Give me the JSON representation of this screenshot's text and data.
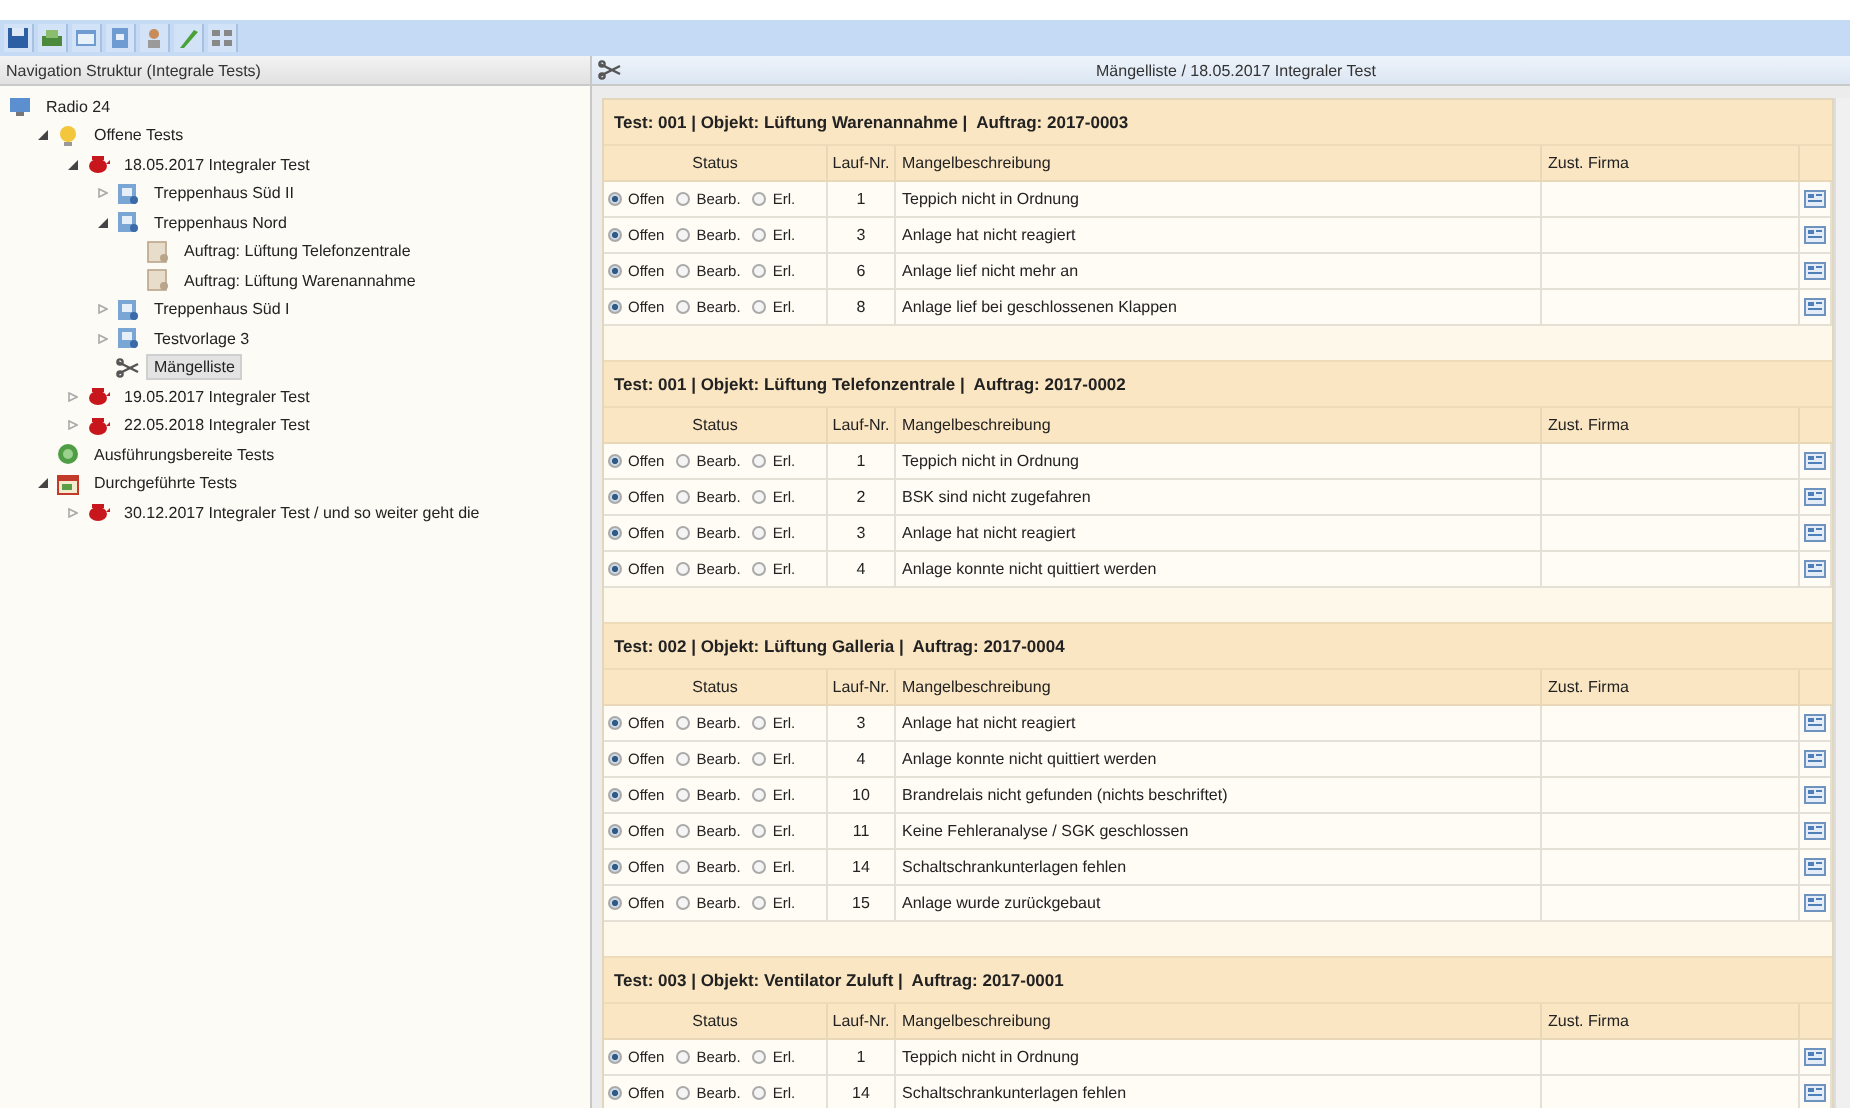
{
  "toolbar": {
    "buttons": [
      {
        "kind": "save"
      },
      {
        "kind": "print"
      },
      {
        "kind": "window"
      },
      {
        "kind": "form"
      },
      {
        "kind": "user"
      },
      {
        "kind": "pen"
      },
      {
        "kind": "grid"
      }
    ]
  },
  "navigation": {
    "title": "Navigation Struktur (Integrale Tests)",
    "tree": [
      {
        "label": "Radio 24",
        "kind": "site",
        "selected": false,
        "children": [
          {
            "label": "Offene Tests",
            "kind": "bulb",
            "expanded": true,
            "selected": false,
            "children": [
              {
                "label": "18.05.2017 Integraler Test",
                "kind": "test",
                "expanded": true,
                "selected": false,
                "children": [
                  {
                    "label": "Treppenhaus Süd II",
                    "kind": "object",
                    "expanded": false,
                    "selected": false
                  },
                  {
                    "label": "Treppenhaus Nord",
                    "kind": "object",
                    "expanded": true,
                    "selected": false,
                    "children": [
                      {
                        "label": "Auftrag: Lüftung Telefonzentrale",
                        "kind": "order",
                        "selected": false
                      },
                      {
                        "label": "Auftrag: Lüftung Warenannahme",
                        "kind": "order",
                        "selected": false
                      }
                    ]
                  },
                  {
                    "label": "Treppenhaus Süd I",
                    "kind": "object",
                    "expanded": false,
                    "selected": false
                  },
                  {
                    "label": "Testvorlage 3",
                    "kind": "object",
                    "expanded": false,
                    "selected": false
                  },
                  {
                    "label": "Mängelliste",
                    "kind": "list",
                    "selected": true
                  }
                ]
              },
              {
                "label": "19.05.2017 Integraler Test",
                "kind": "test",
                "expanded": false,
                "selected": false
              },
              {
                "label": "22.05.2018 Integraler Test",
                "kind": "test",
                "expanded": false,
                "selected": false
              }
            ]
          },
          {
            "label": "Ausführungsbereite Tests",
            "kind": "ready",
            "selected": false
          },
          {
            "label": "Durchgeführte Tests",
            "kind": "done",
            "expanded": true,
            "selected": false,
            "children": [
              {
                "label": "30.12.2017 Integraler Test / und so weiter geht die",
                "kind": "test",
                "expanded": false,
                "selected": false
              }
            ]
          }
        ]
      }
    ]
  },
  "content": {
    "title": "Mängelliste / 18.05.2017 Integraler Test",
    "sections": [
      {
        "title": "Test: 001 | Objekt: Lüftung Warenannahme |  Auftrag: 2017-0003",
        "columns": [
          "Status",
          "Lauf-Nr.",
          "Mangelbeschreibung",
          "Zust. Firma"
        ],
        "rows": [
          {
            "status": [
              {
                "label": "Offen",
                "selected": true
              },
              {
                "label": "Bearb.",
                "selected": false
              },
              {
                "label": "Erl.",
                "selected": false
              }
            ],
            "number": "1",
            "description": "Teppich nicht in Ordnung"
          },
          {
            "status": [
              {
                "label": "Offen",
                "selected": true
              },
              {
                "label": "Bearb.",
                "selected": false
              },
              {
                "label": "Erl.",
                "selected": false
              }
            ],
            "number": "3",
            "description": "Anlage hat nicht reagiert"
          },
          {
            "status": [
              {
                "label": "Offen",
                "selected": true
              },
              {
                "label": "Bearb.",
                "selected": false
              },
              {
                "label": "Erl.",
                "selected": false
              }
            ],
            "number": "6",
            "description": "Anlage lief nicht mehr an"
          },
          {
            "status": [
              {
                "label": "Offen",
                "selected": true
              },
              {
                "label": "Bearb.",
                "selected": false
              },
              {
                "label": "Erl.",
                "selected": false
              }
            ],
            "number": "8",
            "description": "Anlage lief bei geschlossenen Klappen"
          }
        ]
      },
      {
        "title": "Test: 001 | Objekt: Lüftung Telefonzentrale |  Auftrag: 2017-0002",
        "columns": [
          "Status",
          "Lauf-Nr.",
          "Mangelbeschreibung",
          "Zust. Firma"
        ],
        "rows": [
          {
            "status": [
              {
                "label": "Offen",
                "selected": true
              },
              {
                "label": "Bearb.",
                "selected": false
              },
              {
                "label": "Erl.",
                "selected": false
              }
            ],
            "number": "1",
            "description": "Teppich nicht in Ordnung"
          },
          {
            "status": [
              {
                "label": "Offen",
                "selected": true
              },
              {
                "label": "Bearb.",
                "selected": false
              },
              {
                "label": "Erl.",
                "selected": false
              }
            ],
            "number": "2",
            "description": "BSK sind nicht zugefahren"
          },
          {
            "status": [
              {
                "label": "Offen",
                "selected": true
              },
              {
                "label": "Bearb.",
                "selected": false
              },
              {
                "label": "Erl.",
                "selected": false
              }
            ],
            "number": "3",
            "description": "Anlage hat nicht reagiert"
          },
          {
            "status": [
              {
                "label": "Offen",
                "selected": true
              },
              {
                "label": "Bearb.",
                "selected": false
              },
              {
                "label": "Erl.",
                "selected": false
              }
            ],
            "number": "4",
            "description": "Anlage konnte nicht quittiert werden"
          }
        ]
      },
      {
        "title": "Test: 002 | Objekt: Lüftung Galleria |  Auftrag: 2017-0004",
        "columns": [
          "Status",
          "Lauf-Nr.",
          "Mangelbeschreibung",
          "Zust. Firma"
        ],
        "rows": [
          {
            "status": [
              {
                "label": "Offen",
                "selected": true
              },
              {
                "label": "Bearb.",
                "selected": false
              },
              {
                "label": "Erl.",
                "selected": false
              }
            ],
            "number": "3",
            "description": "Anlage hat nicht reagiert"
          },
          {
            "status": [
              {
                "label": "Offen",
                "selected": true
              },
              {
                "label": "Bearb.",
                "selected": false
              },
              {
                "label": "Erl.",
                "selected": false
              }
            ],
            "number": "4",
            "description": "Anlage konnte nicht quittiert werden"
          },
          {
            "status": [
              {
                "label": "Offen",
                "selected": true
              },
              {
                "label": "Bearb.",
                "selected": false
              },
              {
                "label": "Erl.",
                "selected": false
              }
            ],
            "number": "10",
            "description": "Brandrelais nicht gefunden (nichts beschriftet)"
          },
          {
            "status": [
              {
                "label": "Offen",
                "selected": true
              },
              {
                "label": "Bearb.",
                "selected": false
              },
              {
                "label": "Erl.",
                "selected": false
              }
            ],
            "number": "11",
            "description": "Keine Fehleranalyse / SGK geschlossen"
          },
          {
            "status": [
              {
                "label": "Offen",
                "selected": true
              },
              {
                "label": "Bearb.",
                "selected": false
              },
              {
                "label": "Erl.",
                "selected": false
              }
            ],
            "number": "14",
            "description": "Schaltschrankunterlagen fehlen"
          },
          {
            "status": [
              {
                "label": "Offen",
                "selected": true
              },
              {
                "label": "Bearb.",
                "selected": false
              },
              {
                "label": "Erl.",
                "selected": false
              }
            ],
            "number": "15",
            "description": "Anlage wurde zurückgebaut"
          }
        ]
      },
      {
        "title": "Test: 003 | Objekt: Ventilator Zuluft |  Auftrag: 2017-0001",
        "columns": [
          "Status",
          "Lauf-Nr.",
          "Mangelbeschreibung",
          "Zust. Firma"
        ],
        "rows": [
          {
            "status": [
              {
                "label": "Offen",
                "selected": true
              },
              {
                "label": "Bearb.",
                "selected": false
              },
              {
                "label": "Erl.",
                "selected": false
              }
            ],
            "number": "1",
            "description": "Teppich nicht in Ordnung"
          },
          {
            "status": [
              {
                "label": "Offen",
                "selected": true
              },
              {
                "label": "Bearb.",
                "selected": false
              },
              {
                "label": "Erl.",
                "selected": false
              }
            ],
            "number": "14",
            "description": "Schaltschrankunterlagen fehlen"
          }
        ]
      }
    ]
  }
}
